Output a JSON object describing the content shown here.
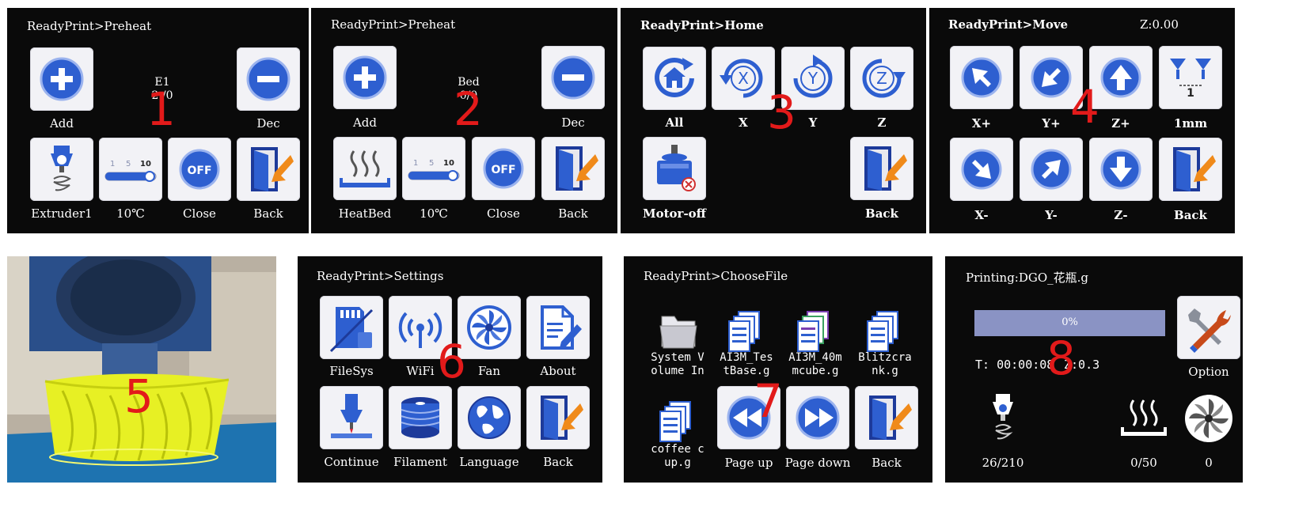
{
  "panel1": {
    "title": "ReadyPrint>Preheat",
    "target": "E1",
    "value": "2 /0",
    "add": "Add",
    "dec": "Dec",
    "tool": "Extruder1",
    "step": "10℃",
    "close": "Close",
    "back": "Back",
    "num": "1",
    "slider_ticks": [
      "1",
      "5",
      "10"
    ],
    "off": "OFF"
  },
  "panel2": {
    "title": "ReadyPrint>Preheat",
    "target": "Bed",
    "value": "0/0",
    "add": "Add",
    "dec": "Dec",
    "tool": "HeatBed",
    "step": "10℃",
    "close": "Close",
    "back": "Back",
    "num": "2",
    "slider_ticks": [
      "1",
      "5",
      "10"
    ],
    "off": "OFF"
  },
  "panel3": {
    "title": "ReadyPrint>Home",
    "all": "All",
    "x": "X",
    "y": "Y",
    "z": "Z",
    "motor_off": "Motor-off",
    "back": "Back",
    "num": "3",
    "x_icon": "X",
    "y_icon": "Y",
    "z_icon": "Z"
  },
  "panel4": {
    "title": "ReadyPrint>Move",
    "z_readout": "Z:0.00",
    "xp": "X+",
    "yp": "Y+",
    "zp": "Z+",
    "step": "1mm",
    "xm": "X-",
    "ym": "Y-",
    "zm": "Z-",
    "back": "Back",
    "num": "4",
    "step_icon": "1"
  },
  "panel5": {
    "num": "5"
  },
  "panel6": {
    "title": "ReadyPrint>Settings",
    "filesys": "FileSys",
    "wifi": "WiFi",
    "fan": "Fan",
    "about": "About",
    "cont": "Continue",
    "filament": "Filament",
    "language": "Language",
    "back": "Back",
    "num": "6"
  },
  "panel7": {
    "title": "ReadyPrint>ChooseFile",
    "files": [
      "System V\nolume In",
      "AI3M_Tes\ntBase.g",
      "AI3M_40m\nmcube.g",
      "Blitzcra\nnk.g",
      "coffee c\nup.g"
    ],
    "page_up": "Page up",
    "page_down": "Page down",
    "back": "Back",
    "num": "7"
  },
  "panel8": {
    "title": "Printing:DGO_花瓶.g",
    "progress": "0%",
    "progress_value": 0,
    "time": "T: 00:00:08",
    "z": "Z:0.3",
    "option": "Option",
    "ext_temp": "26/210",
    "bed_temp": "0/50",
    "fan_speed": "0",
    "num": "8"
  },
  "colors": {
    "icon_blue": "#2e5fd0",
    "icon_dark": "#1d3a9a",
    "label_red": "#e21a1a",
    "tile_bg": "#f2f2f6",
    "progress_bar": "#8a93c4"
  }
}
